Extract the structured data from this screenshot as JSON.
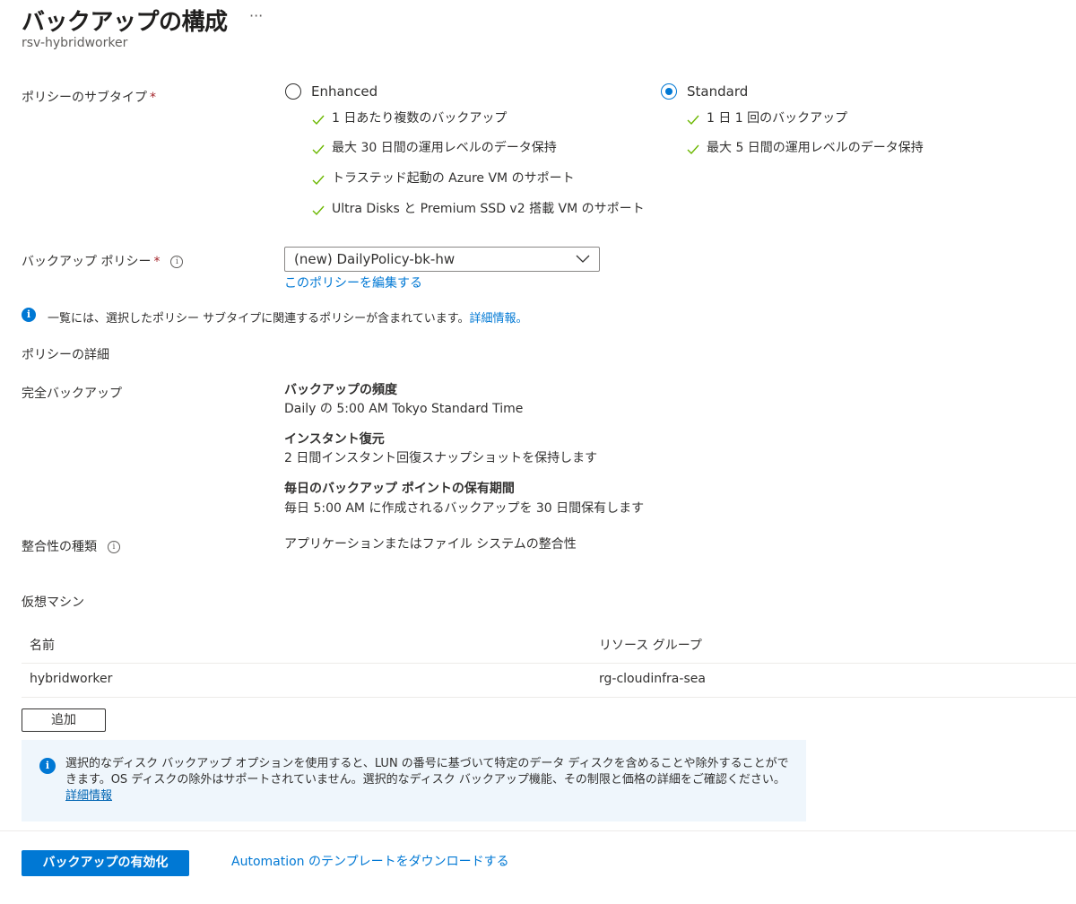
{
  "header": {
    "title": "バックアップの構成",
    "more_label": "···",
    "subtitle": "rsv-hybridworker"
  },
  "policy_subtype": {
    "label": "ポリシーのサブタイプ",
    "required_mark": "*",
    "options": [
      {
        "label": "Enhanced",
        "checked": false,
        "features": [
          "1 日あたり複数のバックアップ",
          "最大 30 日間の運用レベルのデータ保持",
          "トラステッド起動の Azure VM のサポート",
          "Ultra Disks と Premium SSD v2 搭載 VM のサポート"
        ]
      },
      {
        "label": "Standard",
        "checked": true,
        "features": [
          "1 日 1 回のバックアップ",
          "最大 5 日間の運用レベルのデータ保持"
        ]
      }
    ]
  },
  "backup_policy": {
    "label": "バックアップ ポリシー",
    "required_mark": "*",
    "info_glyph": "i",
    "selected": "(new) DailyPolicy-bk-hw",
    "edit_link": "このポリシーを編集する"
  },
  "info_note": {
    "text": "一覧には、選択したポリシー サブタイプに関連するポリシーが含まれています。",
    "link": "詳細情報。",
    "icon_glyph": "i"
  },
  "policy_details": {
    "heading": "ポリシーの詳細",
    "full_backup_label": "完全バックアップ",
    "blocks": [
      {
        "title": "バックアップの頻度",
        "value": "Daily の 5:00 AM Tokyo Standard Time"
      },
      {
        "title": "インスタント復元",
        "value": "2 日間インスタント回復スナップショットを保持します"
      },
      {
        "title": "毎日のバックアップ ポイントの保有期間",
        "value": "毎日 5:00 AM に作成されるバックアップを 30 日間保有します"
      }
    ],
    "consistency_label": "整合性の種類",
    "consistency_info_glyph": "i",
    "consistency_value": "アプリケーションまたはファイル システムの整合性"
  },
  "vm_section": {
    "heading": "仮想マシン",
    "columns": [
      "名前",
      "リソース グループ"
    ],
    "rows": [
      [
        "hybridworker",
        "rg-cloudinfra-sea"
      ]
    ],
    "add_button": "追加"
  },
  "message_bar": {
    "icon_glyph": "i",
    "text": "選択的なディスク バックアップ オプションを使用すると、LUN の番号に基づいて特定のデータ ディスクを含めることや除外することができます。OS ディスクの除外はサポートされていません。選択的なディスク バックアップ機能、その制限と価格の詳細をご確認ください。",
    "link": "詳細情報"
  },
  "footer": {
    "primary_button": "バックアップの有効化",
    "template_link": "Automation のテンプレートをダウンロードする"
  },
  "colors": {
    "accent": "#0078d4",
    "check": "#6bb700",
    "required": "#a4262c",
    "message_bar_bg": "#eff6fc"
  }
}
